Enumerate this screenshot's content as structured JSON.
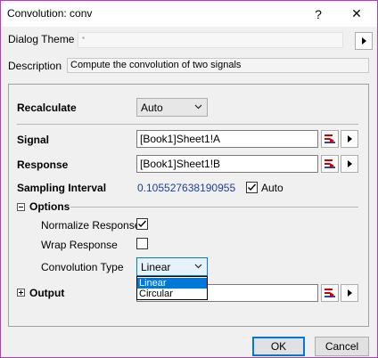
{
  "window": {
    "title": "Convolution: conv",
    "help_label": "?",
    "close_label": "✕"
  },
  "theme": {
    "label": "Dialog Theme",
    "value": "*"
  },
  "description": {
    "label": "Description",
    "value": "Compute the convolution of two signals"
  },
  "recalculate": {
    "label": "Recalculate",
    "value": "Auto"
  },
  "signal": {
    "label": "Signal",
    "value": "[Book1]Sheet1!A"
  },
  "response": {
    "label": "Response",
    "value": "[Book1]Sheet1!B"
  },
  "sampling": {
    "label": "Sampling Interval",
    "value": "0.105527638190955",
    "auto_label": "Auto",
    "auto_checked": true
  },
  "options": {
    "label": "Options",
    "normalize_label": "Normalize Response",
    "normalize_checked": true,
    "wrap_label": "Wrap Response",
    "wrap_checked": false,
    "type_label": "Convolution Type",
    "type_value": "Linear",
    "type_options": [
      "Linear",
      "Circular"
    ]
  },
  "output": {
    "label": "Output"
  },
  "buttons": {
    "ok": "OK",
    "cancel": "Cancel"
  },
  "colors": {
    "accent": "#0078d7",
    "link_value": "#1a3fa0"
  }
}
